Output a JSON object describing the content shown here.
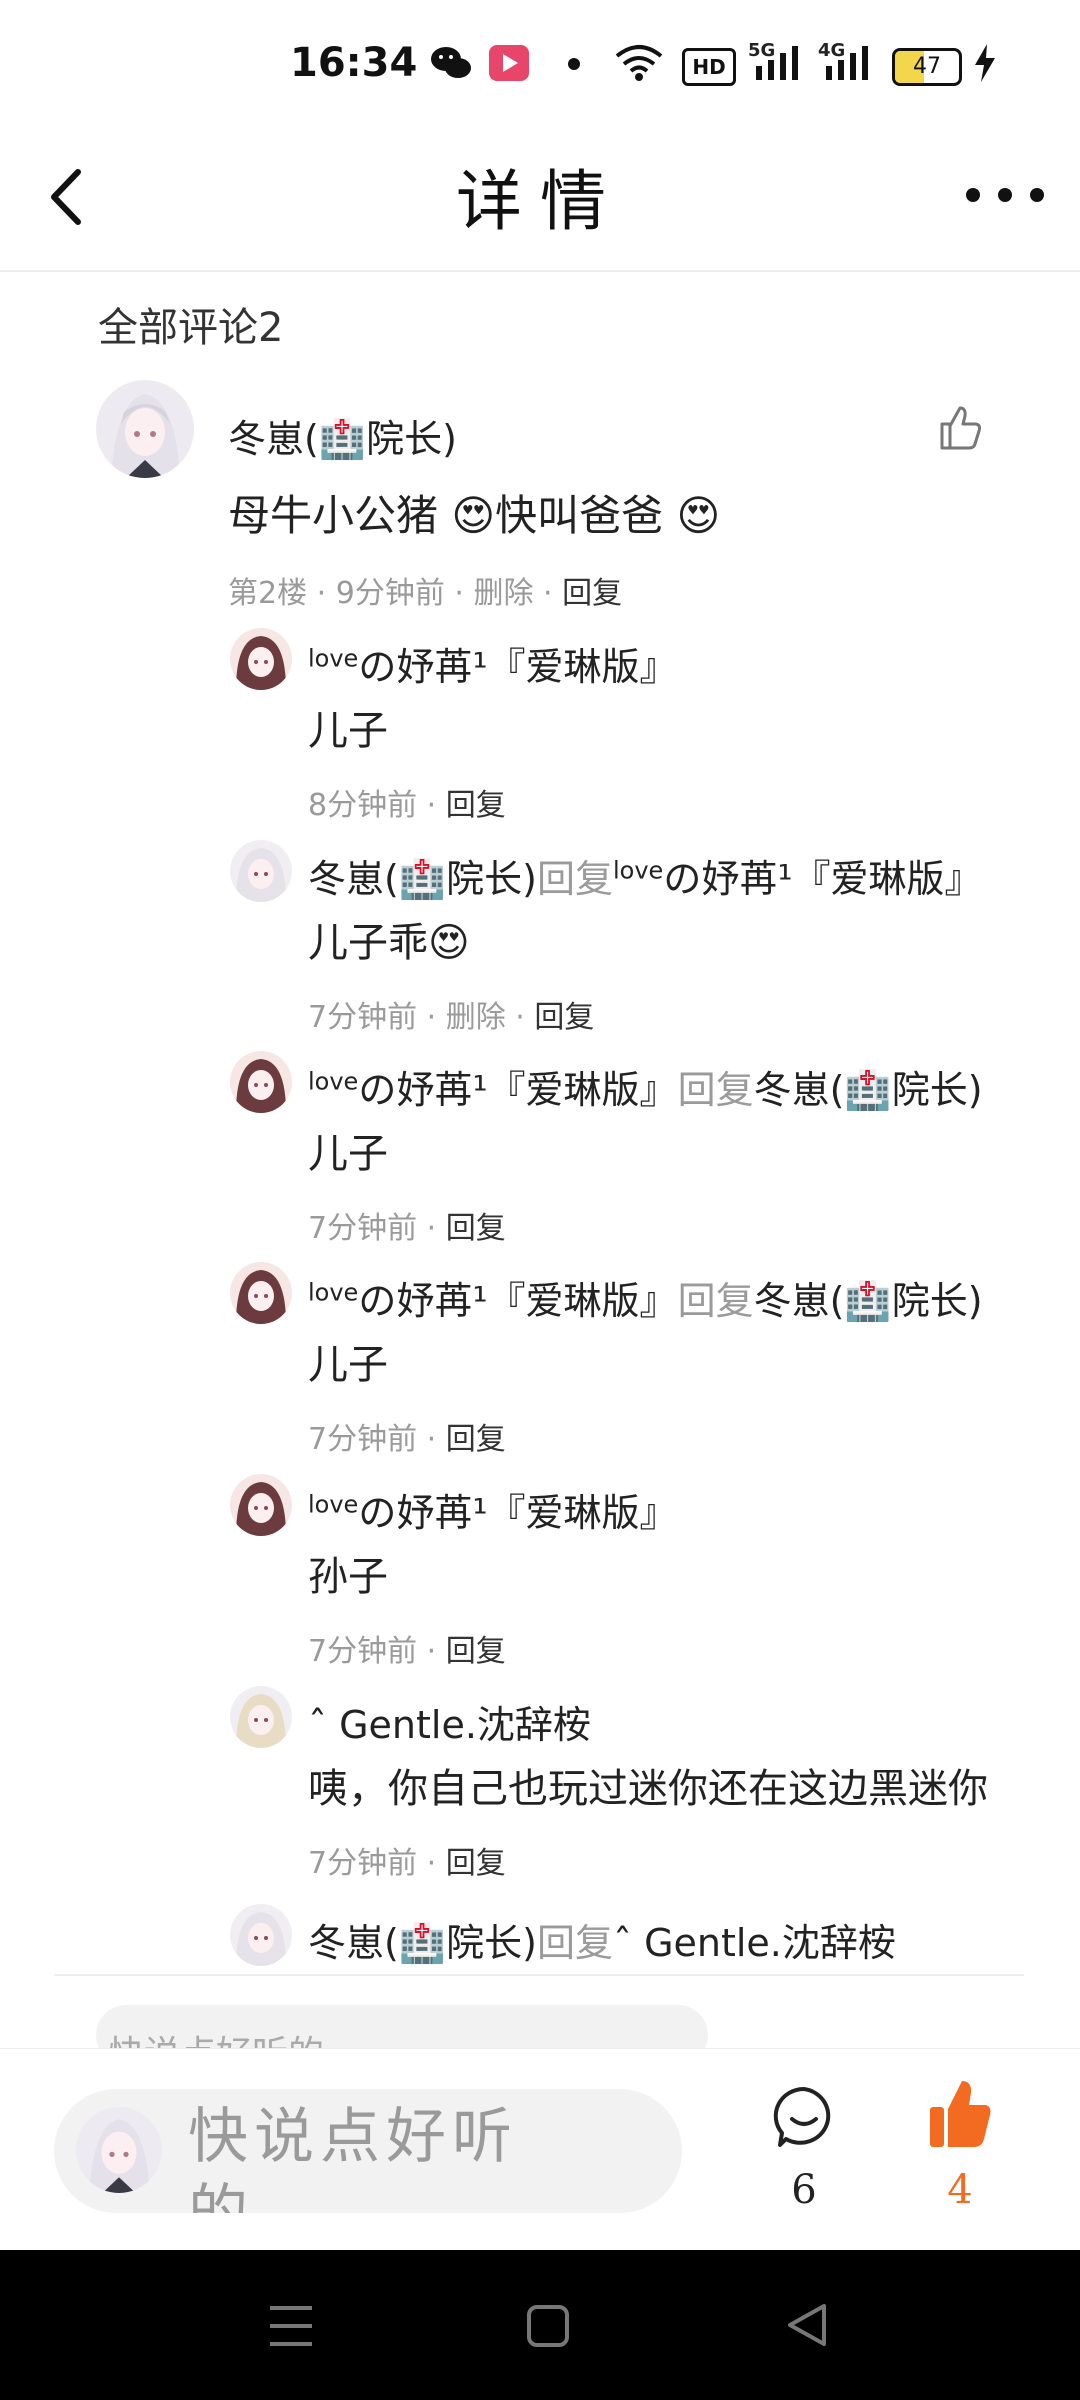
{
  "status_bar": {
    "time": "16:34",
    "battery": "47",
    "hd_label": "HD",
    "signal_5g": "5G",
    "signal_4g": "4G"
  },
  "header": {
    "title": "详情"
  },
  "comments_section": {
    "title": "全部评论2"
  },
  "main_comment": {
    "author": "冬崽(🏥院长)",
    "text": "母牛小公猪 😍快叫爸爸 😍",
    "floor": "第2楼",
    "time": "9分钟前",
    "delete": "删除",
    "reply": "回复"
  },
  "replies": [
    {
      "author_sup": "love",
      "author": "の妤苒¹『爱琳版』",
      "reply_word": "",
      "target": "",
      "text": "儿子",
      "time": "8分钟前",
      "delete": "",
      "reply": "回复"
    },
    {
      "author_sup": "",
      "author": "冬崽(🏥院长)",
      "reply_word": "回复",
      "target_sup": "love",
      "target": "の妤苒¹『爱琳版』",
      "text": "儿子乖😍",
      "time": "7分钟前",
      "delete": "删除",
      "reply": "回复"
    },
    {
      "author_sup": "love",
      "author": "の妤苒¹『爱琳版』",
      "reply_word": "回复",
      "target": "冬崽(🏥院长)",
      "text": "儿子",
      "time": "7分钟前",
      "delete": "",
      "reply": "回复"
    },
    {
      "author_sup": "love",
      "author": "の妤苒¹『爱琳版』",
      "reply_word": "回复",
      "target": "冬崽(🏥院长)",
      "text": "儿子",
      "time": "7分钟前",
      "delete": "",
      "reply": "回复"
    },
    {
      "author_sup": "love",
      "author": "の妤苒¹『爱琳版』",
      "reply_word": "",
      "target": "",
      "text": "孙子",
      "time": "7分钟前",
      "delete": "",
      "reply": "回复"
    },
    {
      "author_sup": "",
      "author": "ˆ Gentle.沈辞桉",
      "reply_word": "",
      "target": "",
      "text": "咦，你自己也玩过迷你还在这边黑迷你",
      "time": "7分钟前",
      "delete": "",
      "reply": "回复"
    },
    {
      "author_sup": "",
      "author": "冬崽(🏥院长)",
      "reply_word": "回复",
      "target": "ˆ Gentle.沈辞桉",
      "text": "",
      "time": "",
      "delete": "",
      "reply": ""
    }
  ],
  "separator": "·",
  "ghost_input": {
    "placeholder": "快说点好听的"
  },
  "bottom_bar": {
    "placeholder": "快说点好听的",
    "comment_count": "6",
    "like_count": "4"
  },
  "colors": {
    "accent": "#f36b21",
    "muted": "#9a9a9a"
  }
}
